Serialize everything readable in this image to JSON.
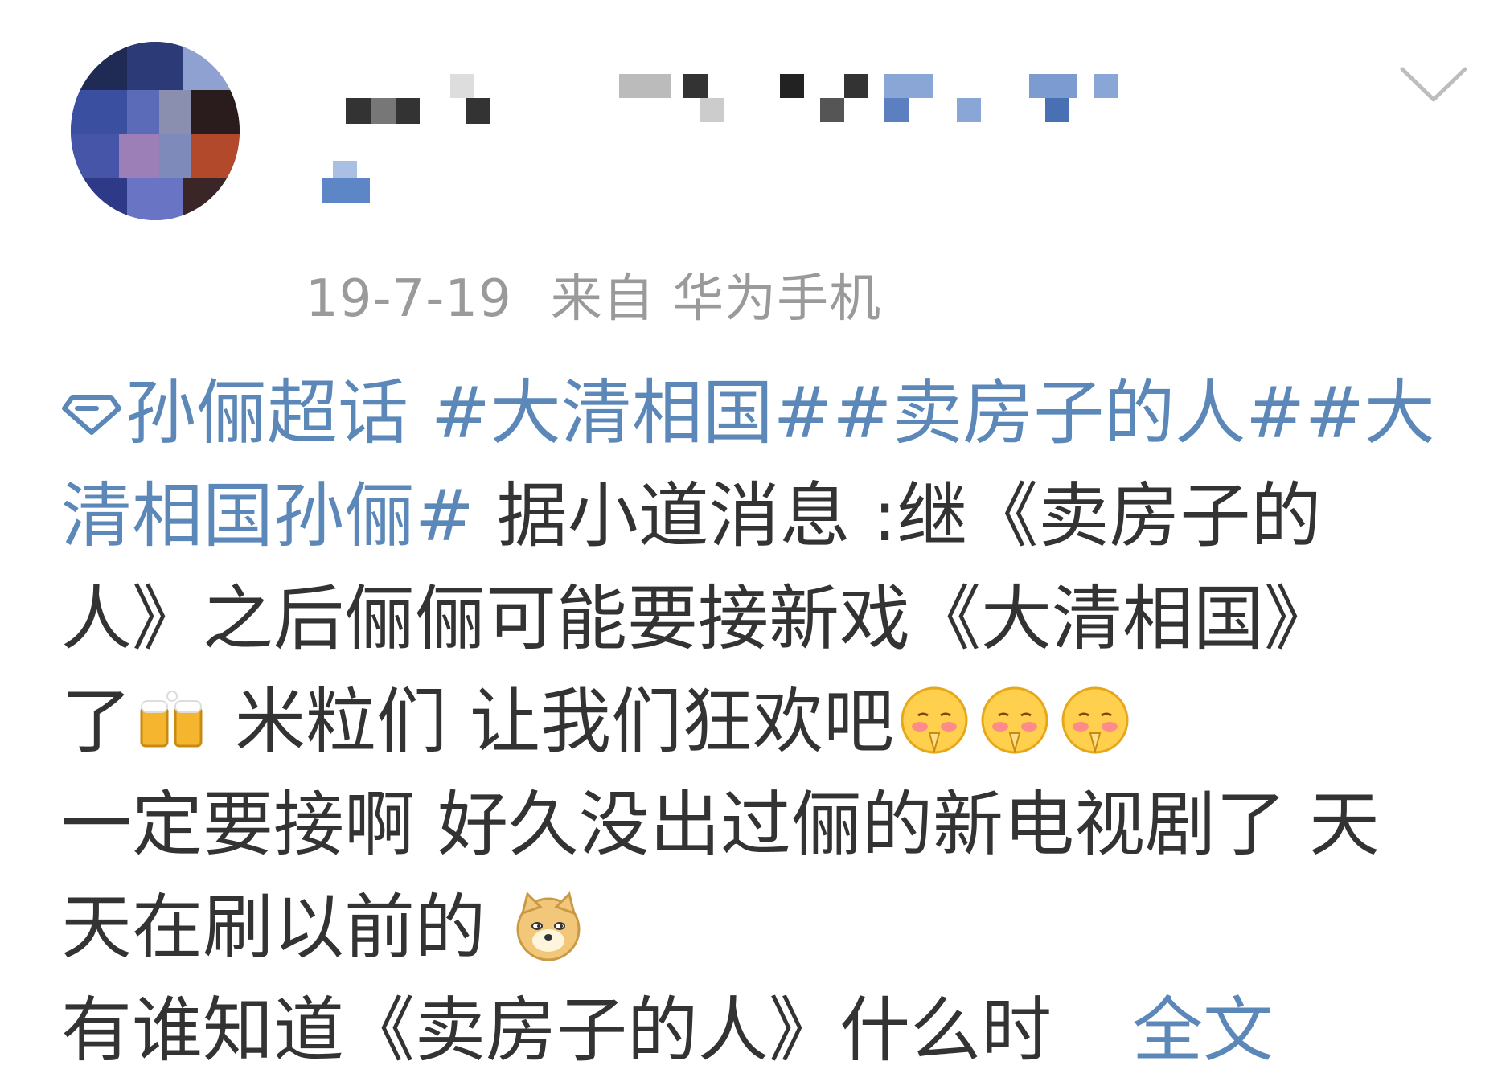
{
  "post": {
    "timestamp": "19-7-19",
    "source": "来自 华为手机",
    "super_topic": "孙俪超话",
    "hashtag_1": "#大清相国#",
    "hashtag_2": "#卖房子的人#",
    "hashtag_3_part1": "#大",
    "hashtag_3_part2": "清相国孙俪#",
    "line2_text": " 据小道消息 :继《卖房子的",
    "line3_text": "人》之后俪俪可能要接新戏《大清相国》",
    "line4_text_a": "了",
    "line4_text_b": " 米粒们 让我们狂欢吧",
    "line5_text": "一定要接啊 好久没出过俪的新电视剧了 天",
    "line6_text": "天在刷以前的 ",
    "line7_text": "有谁知道《卖房子的人》什么时",
    "full_text_link": "全文"
  },
  "icons": {
    "super_topic": "diamond-icon",
    "dropdown": "chevron-down-icon",
    "emoji_cheers": "beer-cheers-emoji",
    "emoji_shy": "shy-pray-emoji",
    "emoji_doge": "doge-emoji"
  },
  "colors": {
    "link": "#5b88b8",
    "text": "#333333",
    "meta": "#9a9a9a"
  }
}
